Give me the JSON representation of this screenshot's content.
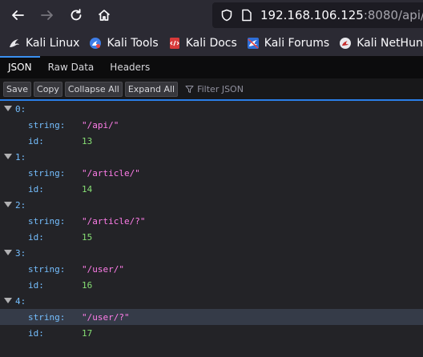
{
  "browser": {
    "url_host": "192.168.106.125",
    "url_rest": ":8080/api/"
  },
  "bookmarks": [
    {
      "label": "Kali Linux",
      "icon": "kali-dragon-icon"
    },
    {
      "label": "Kali Tools",
      "icon": "kali-tools-icon"
    },
    {
      "label": "Kali Docs",
      "icon": "kali-docs-icon"
    },
    {
      "label": "Kali Forums",
      "icon": "kali-forums-icon"
    },
    {
      "label": "Kali NetHunter",
      "icon": "kali-nethunter-icon"
    }
  ],
  "viewer": {
    "tabs": [
      "JSON",
      "Raw Data",
      "Headers"
    ],
    "active_tab": "JSON",
    "actions": [
      "Save",
      "Copy",
      "Collapse All",
      "Expand All"
    ],
    "filter_placeholder": "Filter JSON"
  },
  "items": [
    {
      "index": "0:",
      "string_key": "string:",
      "string_value": "\"/api/\"",
      "id_key": "id:",
      "id_value": "13"
    },
    {
      "index": "1:",
      "string_key": "string:",
      "string_value": "\"/article/\"",
      "id_key": "id:",
      "id_value": "14"
    },
    {
      "index": "2:",
      "string_key": "string:",
      "string_value": "\"/article/?\"",
      "id_key": "id:",
      "id_value": "15"
    },
    {
      "index": "3:",
      "string_key": "string:",
      "string_value": "\"/user/\"",
      "id_key": "id:",
      "id_value": "16"
    },
    {
      "index": "4:",
      "string_key": "string:",
      "string_value": "\"/user/?\"",
      "id_key": "id:",
      "id_value": "17"
    }
  ]
}
